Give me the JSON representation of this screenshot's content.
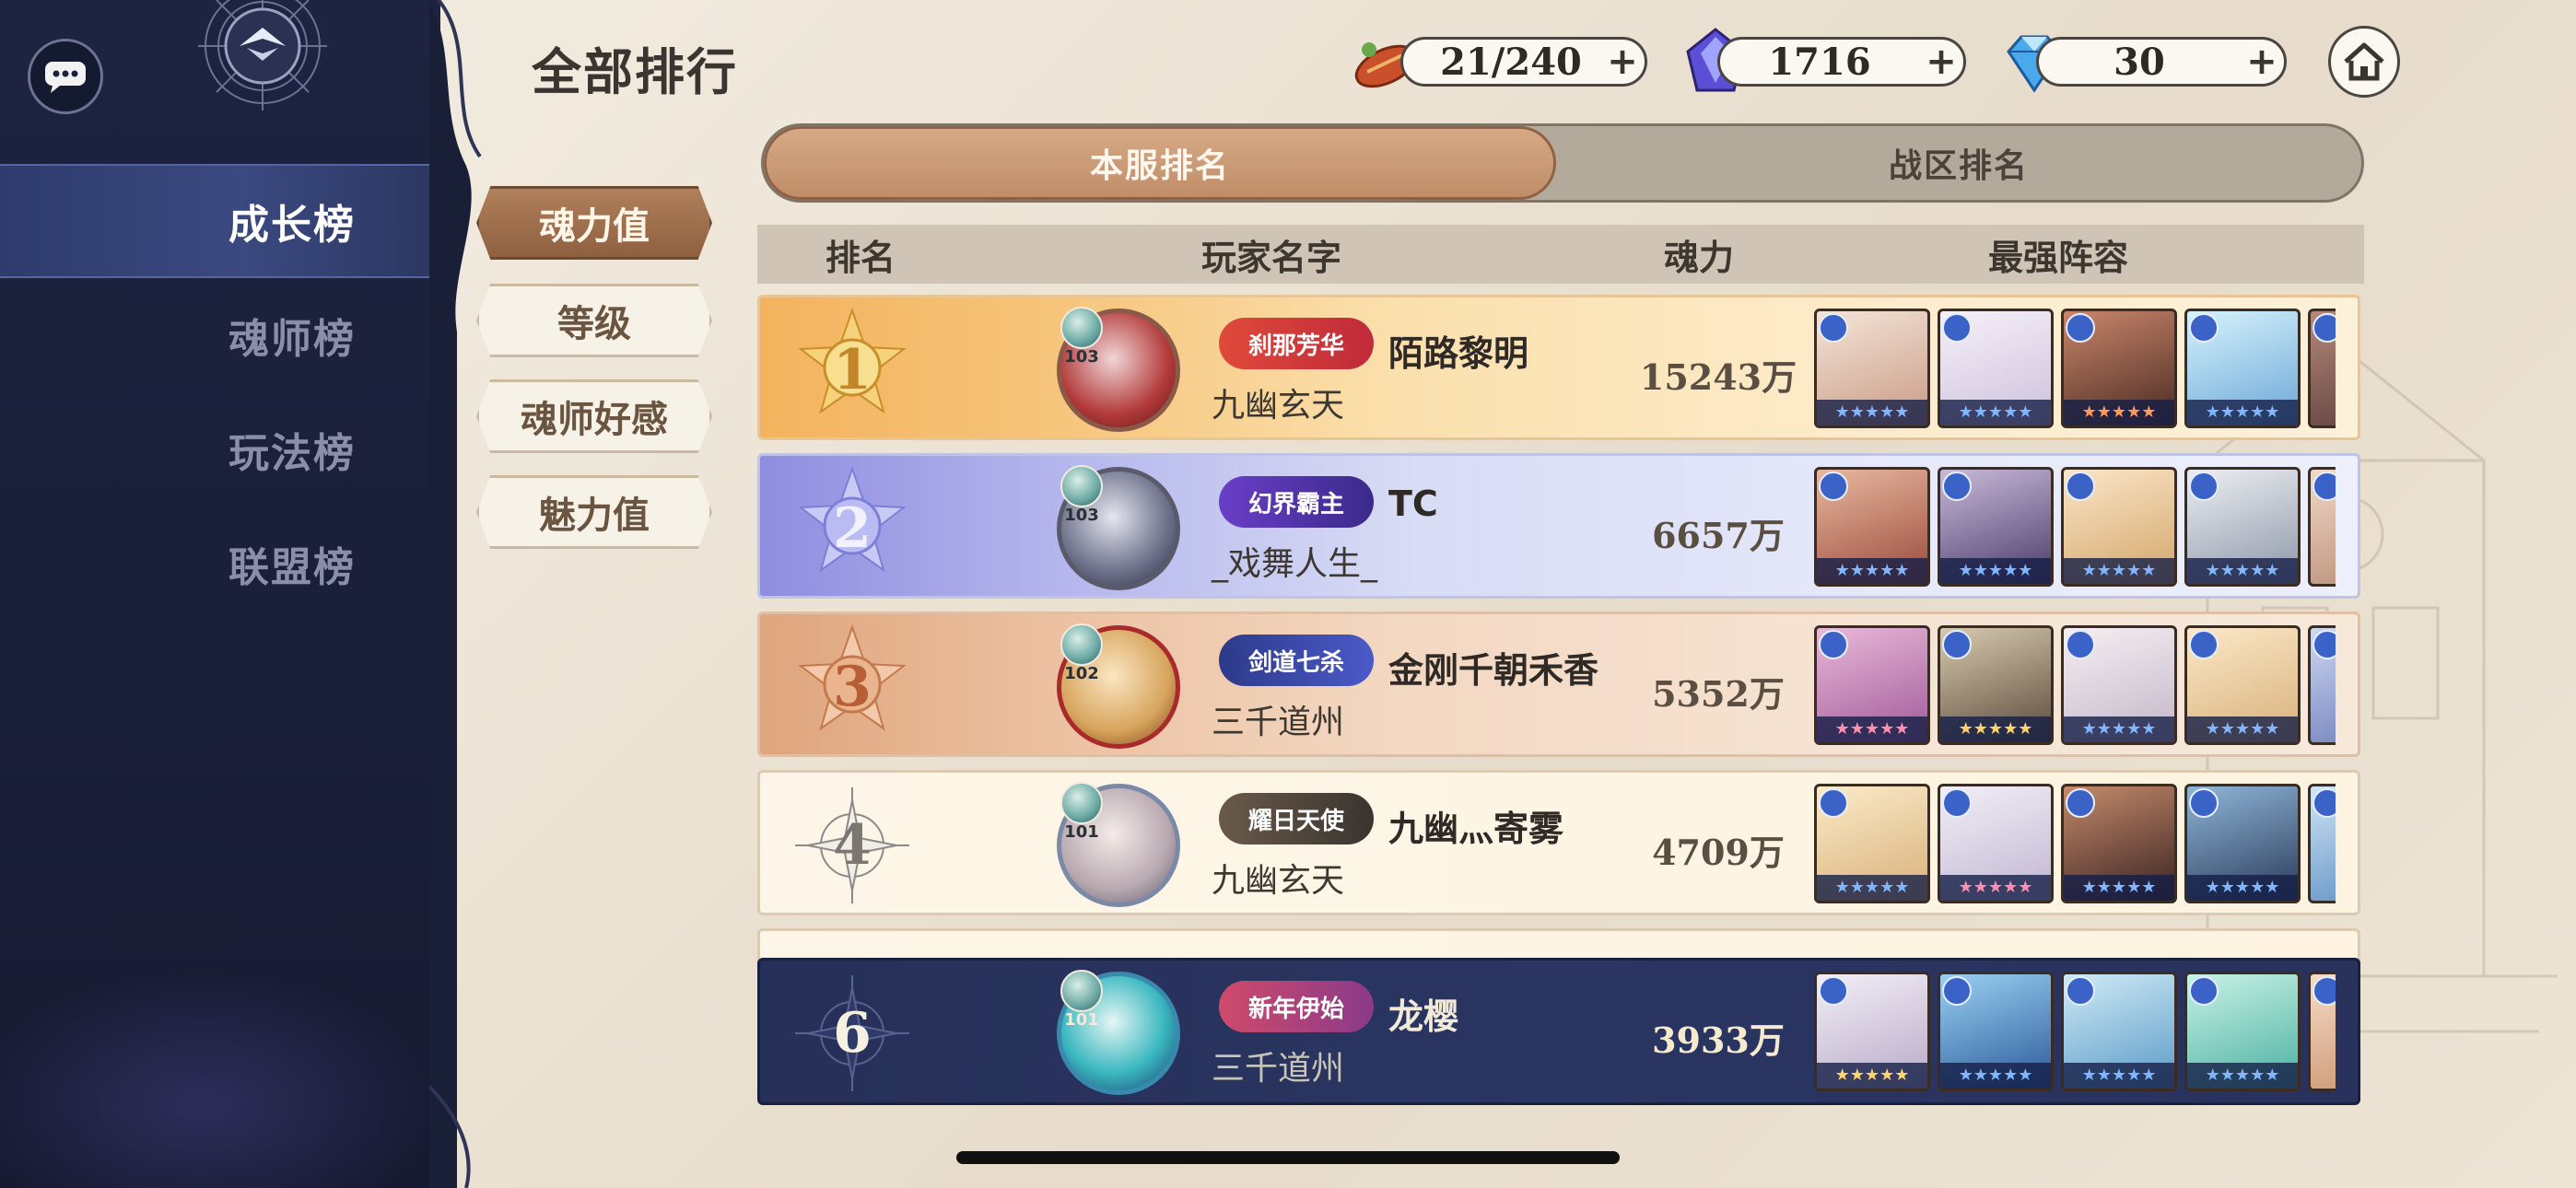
{
  "header": {
    "title": "全部排行",
    "resources": [
      {
        "name": "stamina",
        "icon": "sausage-icon",
        "value": "21/240"
      },
      {
        "name": "soul-crystal",
        "icon": "purple-crystal-icon",
        "value": "1716"
      },
      {
        "name": "diamond",
        "icon": "blue-diamond-icon",
        "value": "30"
      }
    ]
  },
  "sidebar": {
    "items": [
      {
        "label": "成长榜",
        "active": true
      },
      {
        "label": "魂师榜",
        "active": false
      },
      {
        "label": "玩法榜",
        "active": false
      },
      {
        "label": "联盟榜",
        "active": false
      }
    ]
  },
  "categories": [
    {
      "label": "魂力值",
      "active": true
    },
    {
      "label": "等级",
      "active": false
    },
    {
      "label": "魂师好感",
      "active": false
    },
    {
      "label": "魅力值",
      "active": false
    }
  ],
  "tabs": [
    {
      "label": "本服排名",
      "active": true
    },
    {
      "label": "战区排名",
      "active": false
    }
  ],
  "table": {
    "columns": {
      "rank": "排名",
      "name": "玩家名字",
      "power": "魂力",
      "lineup": "最强阵容"
    },
    "rows": [
      {
        "rank": "1",
        "level": "103",
        "title": "刹那芳华",
        "name": "陌路黎明",
        "guild": "九幽玄天",
        "power": "15243万"
      },
      {
        "rank": "2",
        "level": "103",
        "title": "幻界霸主",
        "name": "TC",
        "guild": "_戏舞人生_",
        "power": "6657万"
      },
      {
        "rank": "3",
        "level": "102",
        "title": "剑道七杀",
        "name": "金刚千朝禾香",
        "guild": "三千道州",
        "power": "5352万"
      },
      {
        "rank": "4",
        "level": "101",
        "title": "耀日天使",
        "name": "九幽灬寄雾",
        "guild": "九幽玄天",
        "power": "4709万"
      },
      {
        "rank": "6",
        "level": "101",
        "title": "新年伊始",
        "name": "龙樱",
        "guild": "三千道州",
        "power": "3933万"
      }
    ]
  },
  "colors": {
    "sidebar": "#1d2340",
    "accent": "#b0805c",
    "gold": "#f3b35e",
    "silver": "#8f8de0",
    "bronze": "#dfa57d",
    "self_row": "#263058"
  }
}
